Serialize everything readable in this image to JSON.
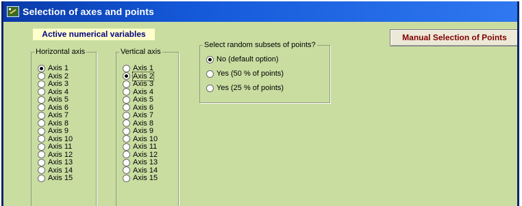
{
  "window": {
    "title": "Selection of axes and points",
    "app_icon": "app-icon"
  },
  "active_label": "Active numerical variables",
  "manual_button": "Manual Selection of Points",
  "horizontal_axis": {
    "legend": "Horizontal axis",
    "selected": "Axis 1",
    "items": [
      "Axis 1",
      "Axis 2",
      "Axis 3",
      "Axis 4",
      "Axis 5",
      "Axis 6",
      "Axis 7",
      "Axis 8",
      "Axis 9",
      "Axis 10",
      "Axis 11",
      "Axis 12",
      "Axis 13",
      "Axis 14",
      "Axis 15"
    ]
  },
  "vertical_axis": {
    "legend": "Vertical axis",
    "selected": "Axis 2",
    "items": [
      "Axis 1",
      "Axis 2",
      "Axis 3",
      "Axis 4",
      "Axis 5",
      "Axis 6",
      "Axis 7",
      "Axis 8",
      "Axis 9",
      "Axis 10",
      "Axis 11",
      "Axis 12",
      "Axis 13",
      "Axis 14",
      "Axis 15"
    ]
  },
  "random_subsets": {
    "legend": "Select random subsets of points?",
    "selected": "No (default option)",
    "options": [
      "No (default option)",
      "Yes  (50 % of points)",
      "Yes (25 % of points)"
    ]
  },
  "colors": {
    "background": "#c9dda1",
    "titlebar": "#1458d8",
    "label_bg": "#ffffcc",
    "label_text": "#000080",
    "button_text": "#800000"
  }
}
